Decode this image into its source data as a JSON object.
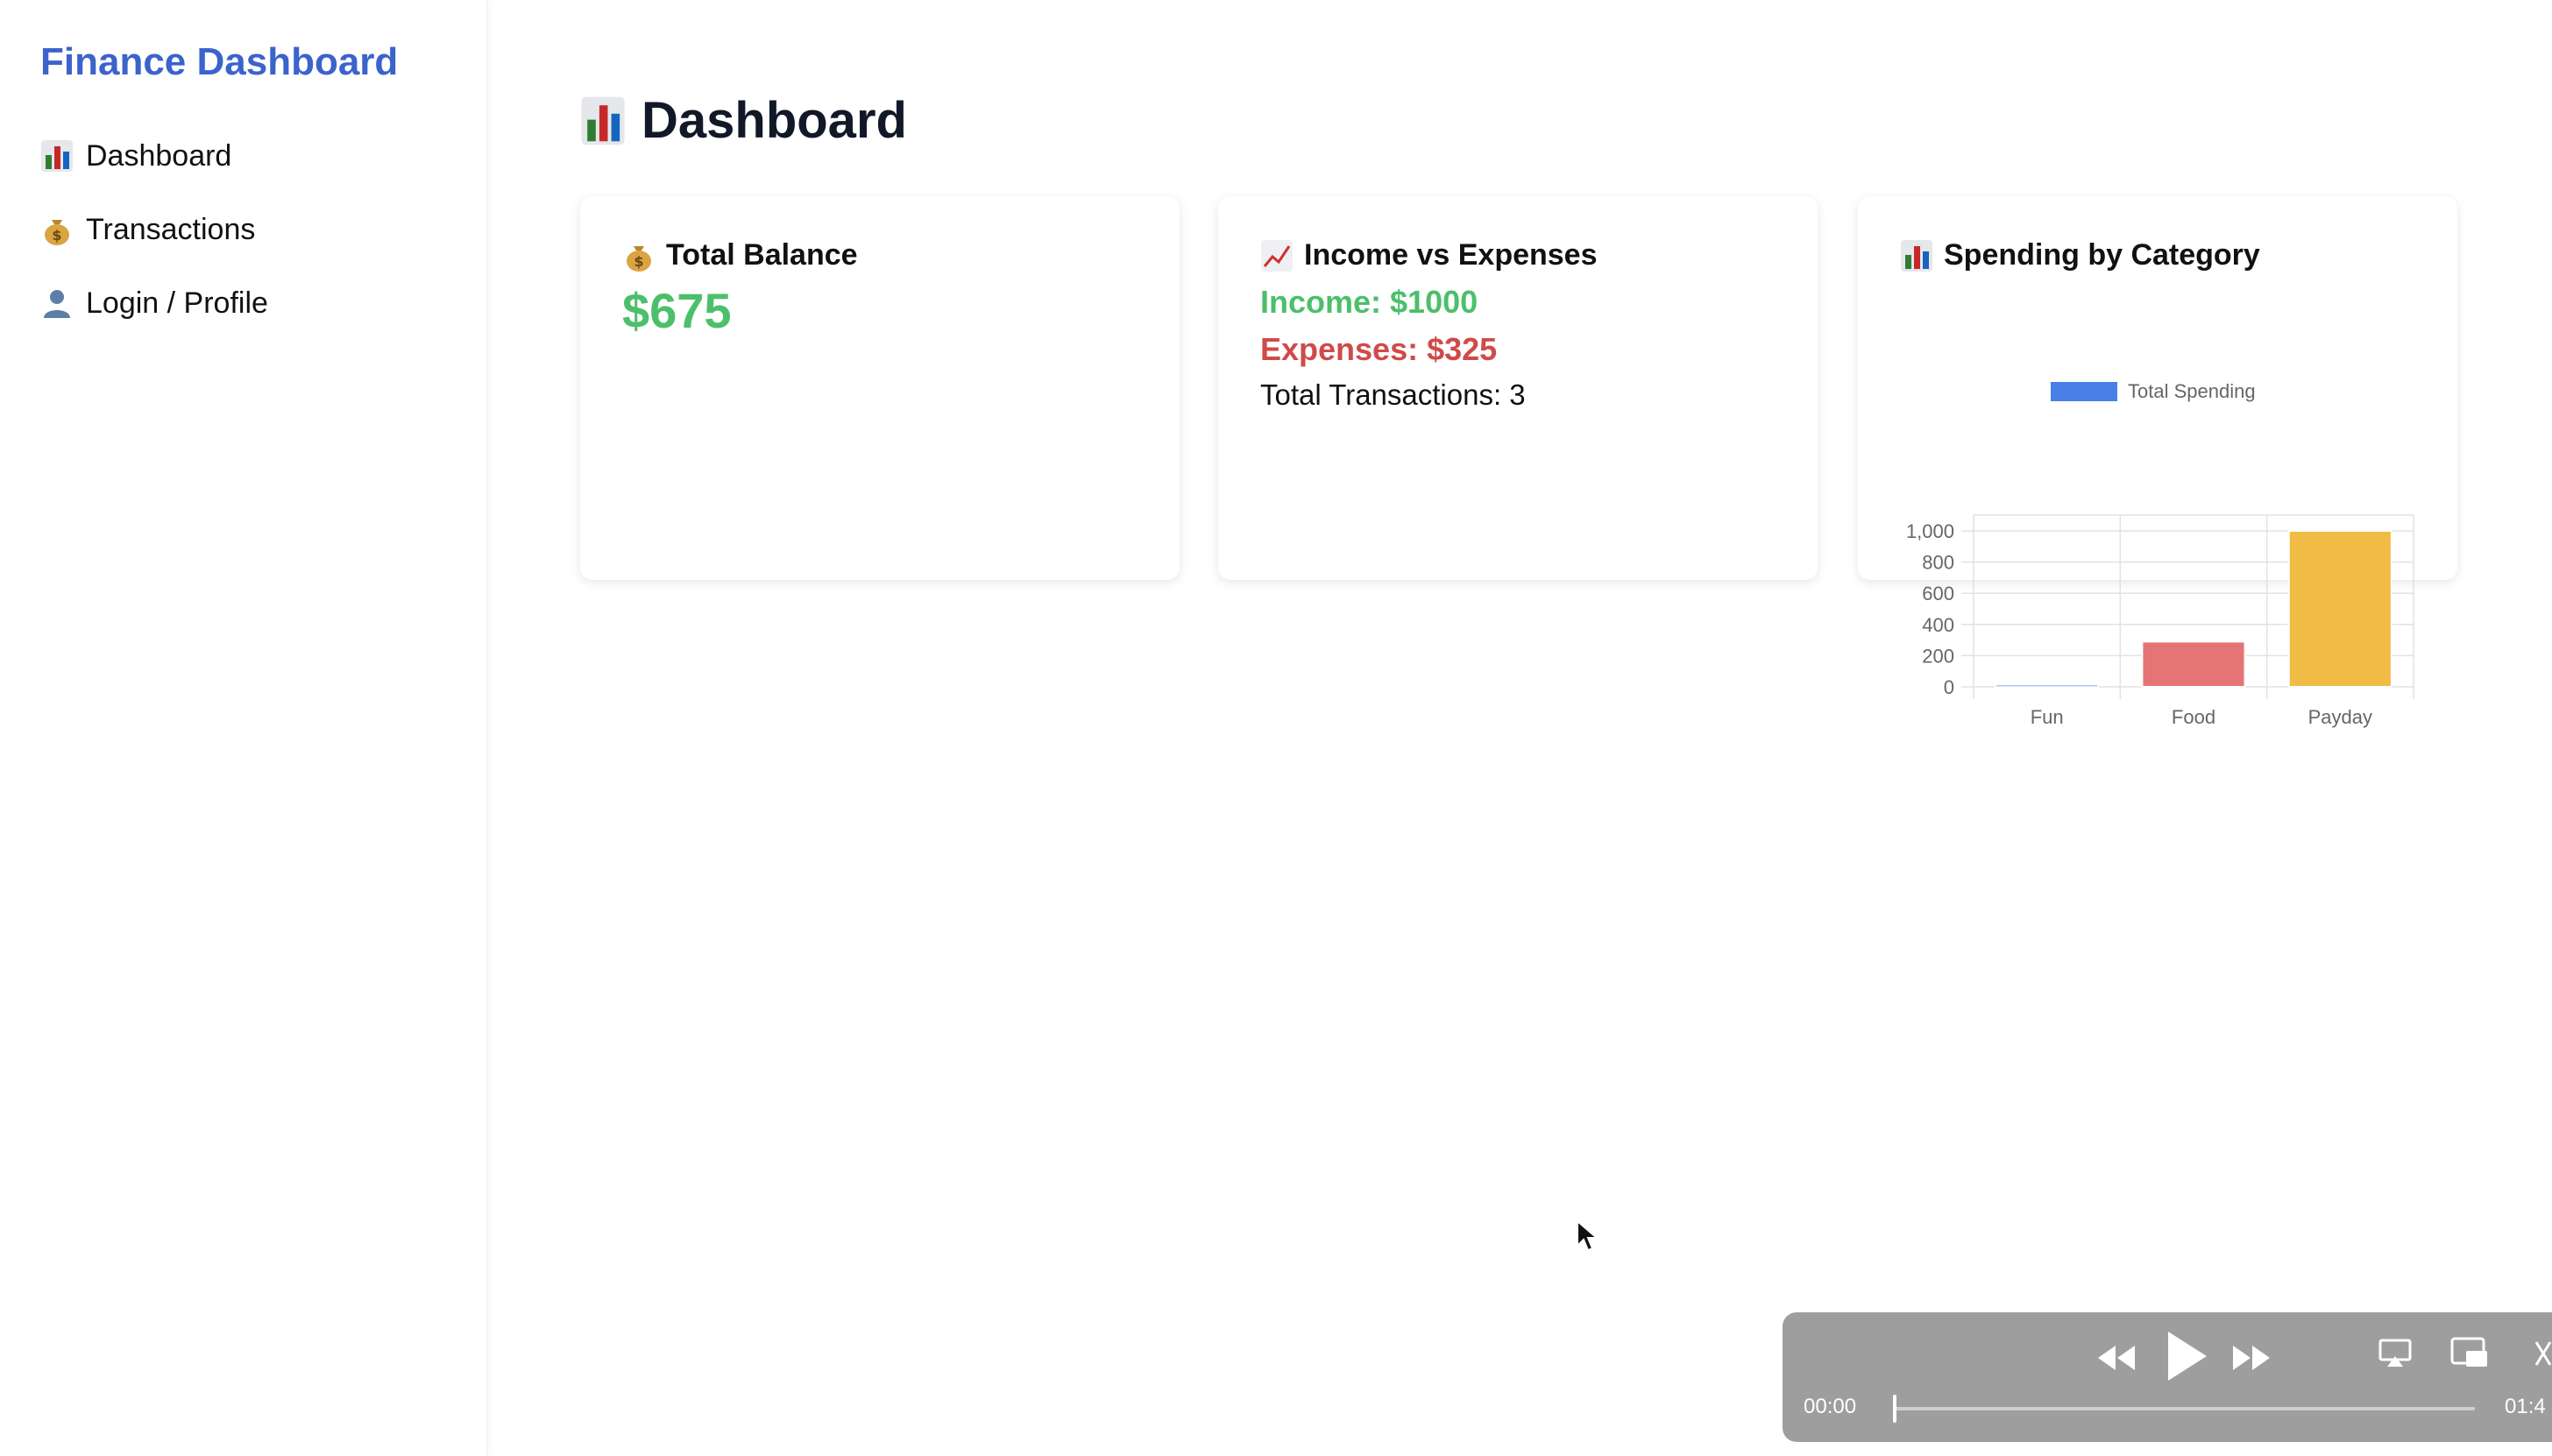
{
  "sidebar": {
    "brand": "Finance Dashboard",
    "items": [
      {
        "label": "Dashboard",
        "icon": "bar-chart-icon"
      },
      {
        "label": "Transactions",
        "icon": "money-bag-icon"
      },
      {
        "label": "Login / Profile",
        "icon": "user-icon"
      }
    ]
  },
  "main": {
    "title": "Dashboard",
    "title_icon": "bar-chart-icon"
  },
  "cards": {
    "balance": {
      "title": "Total Balance",
      "value": "$675",
      "icon": "money-bag-icon"
    },
    "income_expenses": {
      "title": "Income vs Expenses",
      "icon": "trend-up-icon",
      "income": "Income: $1000",
      "expenses": "Expenses: $325",
      "total": "Total Transactions: 3"
    },
    "spending": {
      "title": "Spending by Category",
      "icon": "bar-chart-icon"
    }
  },
  "chart_data": {
    "type": "bar",
    "categories": [
      "Fun",
      "Food",
      "Payday"
    ],
    "series": [
      {
        "name": "Total Spending",
        "values": [
          15,
          290,
          1000
        ]
      }
    ],
    "bar_colors": [
      "#8fa8ea",
      "#e57575",
      "#f0bc45"
    ],
    "legend_color": "#4a7fe8",
    "ylim": [
      0,
      1000
    ],
    "yticks": [
      "1,000",
      "800",
      "600",
      "400",
      "200",
      "0"
    ],
    "ytick_values": [
      1000,
      800,
      600,
      400,
      200,
      0
    ],
    "grid": true,
    "legend": "top"
  },
  "player": {
    "current_time": "00:00",
    "duration": "01:4",
    "progress": 0.0
  },
  "colors": {
    "brand": "#3b63cc",
    "income": "#4cbf6a",
    "expense": "#d04a4a"
  }
}
